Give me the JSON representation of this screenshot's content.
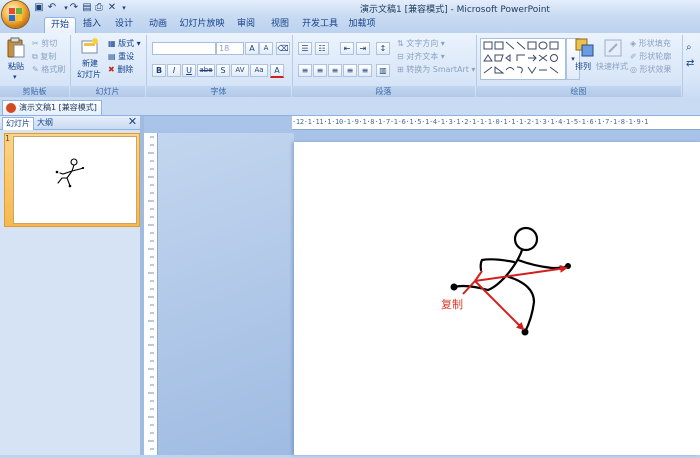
{
  "app": {
    "window_title": "演示文稿1 [兼容模式] - Microsoft PowerPoint",
    "document_tab": "演示文稿1 [兼容模式]"
  },
  "tabs": [
    "开始",
    "插入",
    "设计",
    "动画",
    "幻灯片放映",
    "审阅",
    "视图",
    "开发工具",
    "加载项"
  ],
  "active_tab": "开始",
  "ribbon": {
    "clipboard": {
      "label": "剪贴板",
      "paste": "粘贴",
      "cut": "剪切",
      "copy": "复制",
      "format_painter": "格式刷"
    },
    "slides": {
      "label": "幻灯片",
      "new_slide_1": "新建",
      "new_slide_2": "幻灯片",
      "layout": "版式",
      "reset": "重设",
      "delete": "删除"
    },
    "font": {
      "label": "字体",
      "size": "18",
      "buttons": [
        "B",
        "I",
        "U",
        "abe",
        "S",
        "AV",
        "Aa",
        "A"
      ]
    },
    "paragraph": {
      "label": "段落",
      "text_direction": "文字方向",
      "align_text": "对齐文本",
      "convert_smartart": "转换为 SmartArt"
    },
    "drawing": {
      "label": "绘图",
      "arrange": "排列",
      "quick_styles": "快速样式",
      "shape_fill": "形状填充",
      "shape_outline": "形状轮廓",
      "shape_effects": "形状效果"
    }
  },
  "slides_pane": {
    "tab_slides": "幻灯片",
    "tab_outline": "大纲",
    "close": "✕",
    "slide_number": "1"
  },
  "ruler": {
    "horizontal": "·12·1·11·1·10·1·9·1·8·1·7·1·6·1·5·1·4·1·3·1·2·1·1·1·0·1·1·1·2·1·3·1·4·1·5·1·6·1·7·1·8·1·9·1"
  },
  "slide": {
    "annotation": "复制",
    "accent_color": "#d41e1e",
    "figure_color": "#000000"
  },
  "colors": {
    "ribbon_bg": "#dbe8f9",
    "workspace": "#9fbbe2",
    "selected_thumb": "#f7b850"
  }
}
